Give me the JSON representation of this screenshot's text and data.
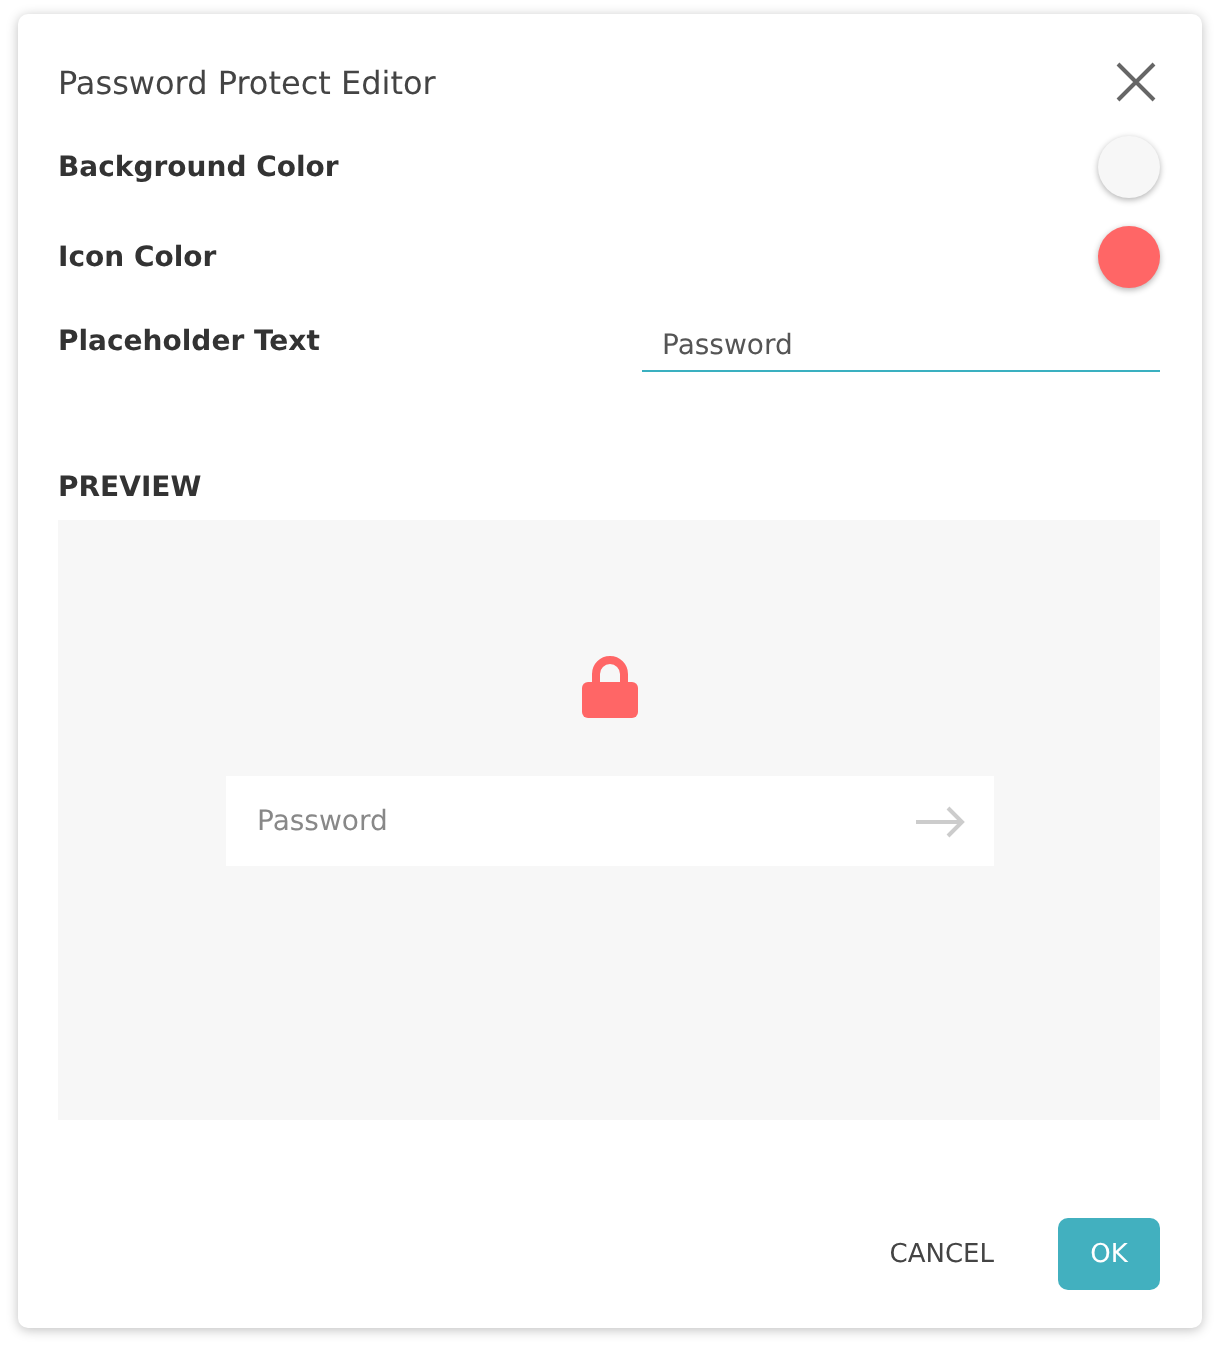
{
  "dialog": {
    "title": "Password Protect Editor"
  },
  "settings": [
    {
      "kind": "color",
      "label": "Background Color",
      "color": "#f7f7f7"
    },
    {
      "kind": "color",
      "label": "Icon Color",
      "color": "#ff6666"
    },
    {
      "kind": "text",
      "label": "Placeholder Text",
      "value": "Password"
    }
  ],
  "preview": {
    "heading": "PREVIEW",
    "placeholder": "Password"
  },
  "buttons": [
    {
      "kind": "text",
      "label": "CANCEL"
    },
    {
      "kind": "primary",
      "label": "OK"
    }
  ]
}
